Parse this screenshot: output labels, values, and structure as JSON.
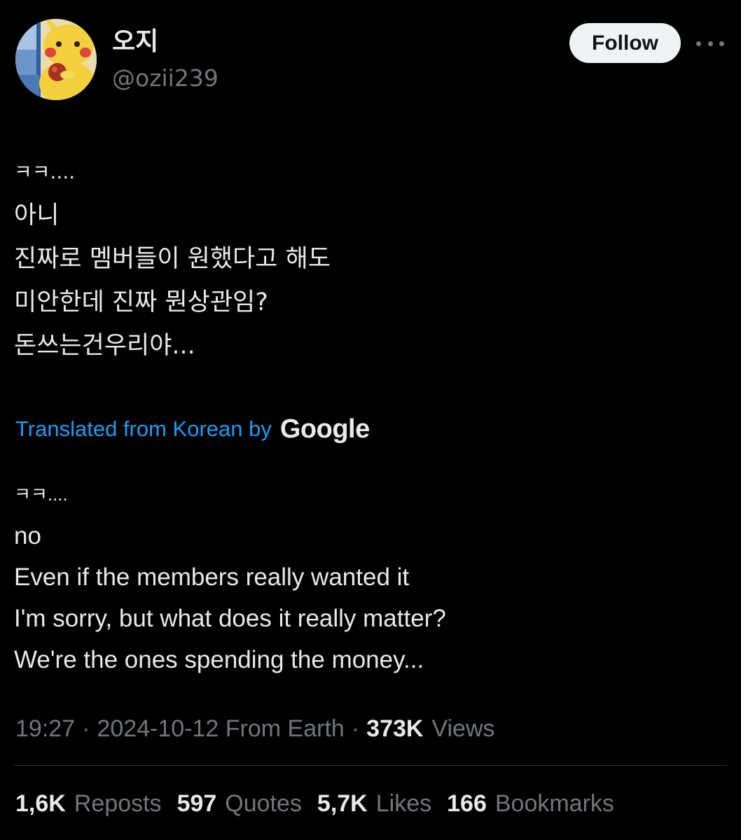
{
  "colors": {
    "background": "#000000",
    "text_primary": "#e7e9ea",
    "text_secondary": "#71767b",
    "accent_link": "#1d9bf0",
    "follow_button_bg": "#eff3f4",
    "divider": "#2f3336"
  },
  "author": {
    "display_name": "오지",
    "handle": "@ozii239",
    "avatar_icon": "pikachu-avatar"
  },
  "actions": {
    "follow_label": "Follow",
    "more_icon": "more-horizontal-icon"
  },
  "tweet": {
    "original_lines": [
      "ㅋㅋ....",
      "아니",
      "진짜로 멤버들이 원했다고 해도",
      "미안한데 진짜 뭔상관임?",
      "돈쓰는건우리야..."
    ],
    "translation": {
      "label": "Translated from Korean by",
      "provider": "Google"
    },
    "translated_lines": [
      "ㅋㅋ....",
      "no",
      "Even if the members really wanted it",
      "I'm sorry, but what does it really matter?",
      "We're the ones spending the money..."
    ]
  },
  "meta": {
    "time": "19:27",
    "separator": "·",
    "date_source": "2024-10-12 From Earth",
    "views_count": "373K",
    "views_label": "Views"
  },
  "stats": [
    {
      "count": "1,6K",
      "label": "Reposts"
    },
    {
      "count": "597",
      "label": "Quotes"
    },
    {
      "count": "5,7K",
      "label": "Likes"
    },
    {
      "count": "166",
      "label": "Bookmarks"
    }
  ]
}
